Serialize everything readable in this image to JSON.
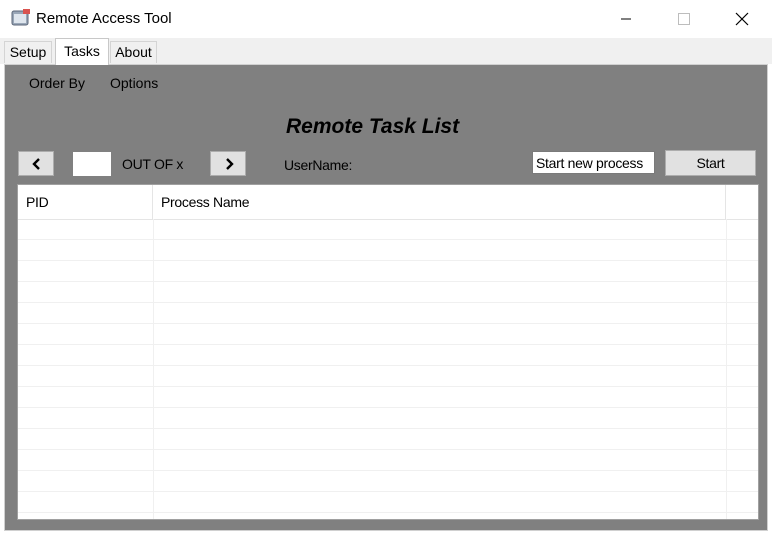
{
  "window": {
    "title": "Remote Access Tool",
    "icon": "app-window-icon",
    "controls": [
      "minimize-icon",
      "maximize-icon",
      "close-icon"
    ]
  },
  "tabs": [
    {
      "label": "Setup",
      "active": false
    },
    {
      "label": "Tasks",
      "active": true
    },
    {
      "label": "About",
      "active": false
    }
  ],
  "menu": {
    "order_by": "Order By",
    "options": "Options"
  },
  "heading": "Remote Task List",
  "pager": {
    "prev_icon": "chevron-left-icon",
    "next_icon": "chevron-right-icon",
    "page_value": "",
    "out_of_label": "OUT OF x"
  },
  "username_label": "UserName:",
  "process": {
    "input_value": "Start new process",
    "start_label": "Start"
  },
  "table": {
    "columns": [
      "PID",
      "Process Name",
      ""
    ],
    "rows": []
  },
  "colors": {
    "panel_background": "#808080",
    "button_face": "#e1e1e1"
  }
}
